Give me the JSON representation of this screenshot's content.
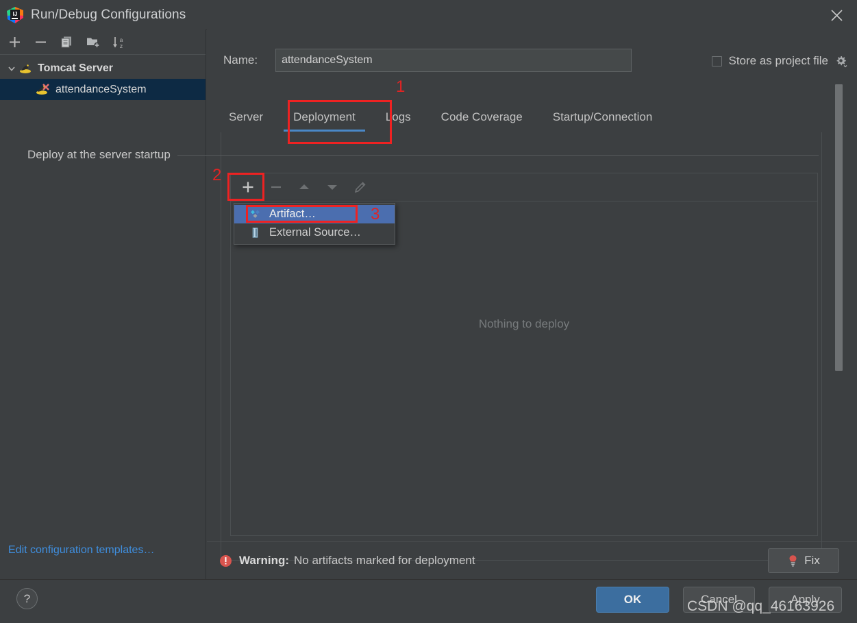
{
  "window": {
    "title": "Run/Debug Configurations",
    "app_icon": "intellij-idea-icon",
    "close_icon": "close-icon"
  },
  "sidebar": {
    "toolbar": [
      {
        "name": "add-configuration-button",
        "icon": "plus-icon",
        "glyph": "+"
      },
      {
        "name": "remove-configuration-button",
        "icon": "minus-icon",
        "glyph": "−"
      },
      {
        "name": "copy-configuration-button",
        "icon": "copy-icon",
        "glyph": "copy"
      },
      {
        "name": "save-configuration-button",
        "icon": "folder-add-icon",
        "glyph": "folder"
      },
      {
        "name": "sort-configurations-button",
        "icon": "sort-alphabetically-icon",
        "glyph": "sort"
      }
    ],
    "tree": [
      {
        "label": "Tomcat Server",
        "icon": "tomcat-icon",
        "expanded": true,
        "selected": false,
        "level": 0
      },
      {
        "label": "attendanceSystem",
        "icon": "tomcat-run-icon",
        "expanded": false,
        "selected": true,
        "level": 1
      }
    ],
    "edit_templates_link": "Edit configuration templates…"
  },
  "form": {
    "name_label": "Name:",
    "name_value": "attendanceSystem",
    "name_placeholder": "",
    "store_as_project_file_label": "Store as project file",
    "store_as_project_file_checked": false,
    "store_settings_icon": "gear-icon"
  },
  "tabs": [
    {
      "label": "Server",
      "active": false
    },
    {
      "label": "Deployment",
      "active": true
    },
    {
      "label": "Logs",
      "active": false
    },
    {
      "label": "Code Coverage",
      "active": false
    },
    {
      "label": "Startup/Connection",
      "active": false
    }
  ],
  "deployment": {
    "section_title": "Deploy at the server startup",
    "toolbar": [
      {
        "name": "add-deployment-button",
        "icon": "plus-icon",
        "glyph": "+",
        "enabled": true
      },
      {
        "name": "remove-deployment-button",
        "icon": "minus-icon",
        "glyph": "−",
        "enabled": false
      },
      {
        "name": "move-up-button",
        "icon": "arrow-up-icon",
        "glyph": "▲",
        "enabled": false
      },
      {
        "name": "move-down-button",
        "icon": "arrow-down-icon",
        "glyph": "▼",
        "enabled": false
      },
      {
        "name": "edit-deployment-button",
        "icon": "pencil-icon",
        "glyph": "pencil",
        "enabled": false
      }
    ],
    "empty_text": "Nothing to deploy",
    "popup_menu": [
      {
        "label": "Artifact…",
        "icon": "artifact-icon",
        "selected": true
      },
      {
        "label": "External Source…",
        "icon": "external-source-icon",
        "selected": false
      }
    ]
  },
  "warning": {
    "icon": "error-circle-icon",
    "prefix": "Warning:",
    "message": "No artifacts marked for deployment",
    "fix_label": "Fix",
    "fix_icon": "lightbulb-icon"
  },
  "footer": {
    "help_label": "?",
    "ok_label": "OK",
    "cancel_label": "Cancel",
    "apply_label": "Apply"
  },
  "annotations": [
    {
      "number": "1",
      "target": "deployment-tab"
    },
    {
      "number": "2",
      "target": "add-deployment-button"
    },
    {
      "number": "3",
      "target": "artifact-menu-item"
    }
  ],
  "watermark": "CSDN @qq_46163926",
  "colors": {
    "background": "#3c3f41",
    "accent_blue": "#4a88c7",
    "selection_blue": "#4b6eaf",
    "tree_selection": "#0d2a44",
    "link_blue": "#3f8fe0",
    "annotation_red": "#ee2222",
    "warning_red": "#d8544e",
    "ok_button": "#3c6e9f"
  }
}
